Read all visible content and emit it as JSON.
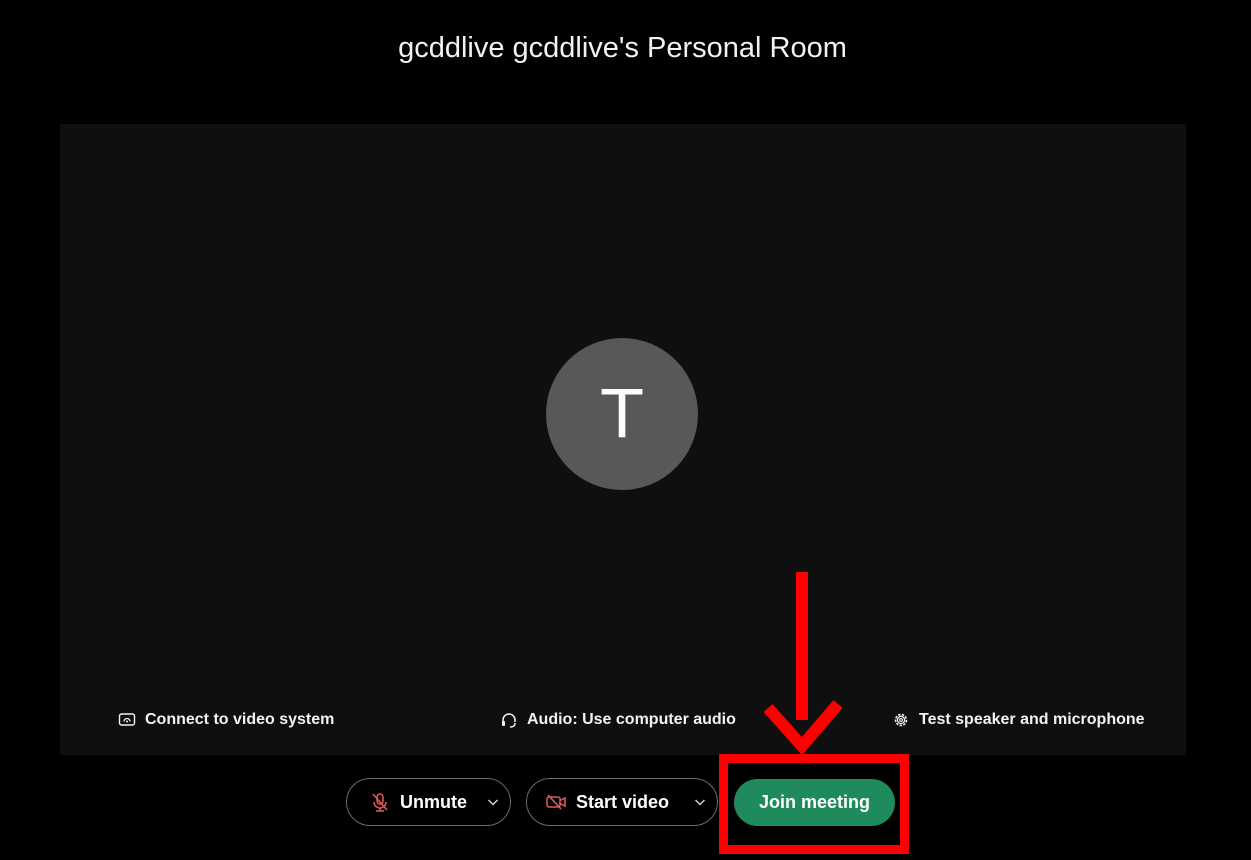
{
  "room": {
    "title": "gcddlive gcddlive's Personal Room"
  },
  "avatar": {
    "initial": "T"
  },
  "options": {
    "video_system": "Connect to video system",
    "audio": "Audio: Use computer audio",
    "test": "Test speaker and microphone"
  },
  "controls": {
    "unmute": "Unmute",
    "start_video": "Start video",
    "join": "Join meeting"
  },
  "colors": {
    "join_button": "#1f8a5c",
    "muted_icon": "#e05a5a",
    "annotation": "#ff0000",
    "avatar_bg": "#585858"
  },
  "icons": {
    "video_system": "screen-cast-icon",
    "audio": "headset-icon",
    "test": "gear-icon",
    "unmute": "microphone-muted-icon",
    "start_video": "camera-off-icon",
    "dropdown": "chevron-down-icon"
  }
}
